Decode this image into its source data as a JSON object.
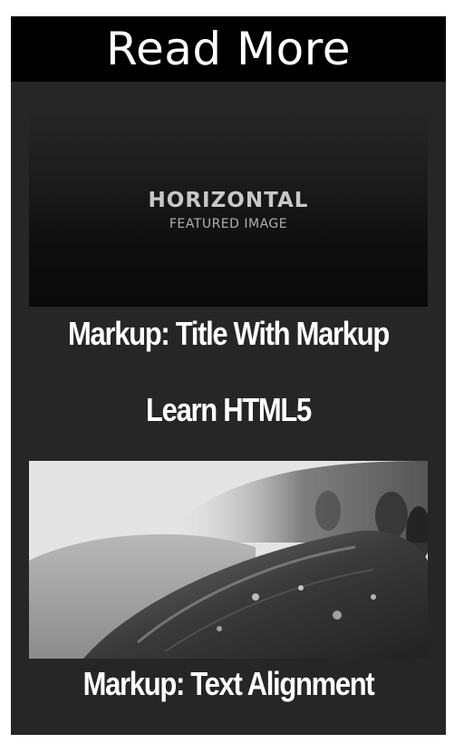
{
  "widget": {
    "title": "Read More"
  },
  "posts": [
    {
      "thumbnail_main": "HORIZONTAL",
      "thumbnail_sub": "FEATURED IMAGE",
      "title": "Markup: Title With Markup"
    },
    {
      "title": "Learn HTML5"
    },
    {
      "title": "Markup: Text Alignment"
    }
  ]
}
